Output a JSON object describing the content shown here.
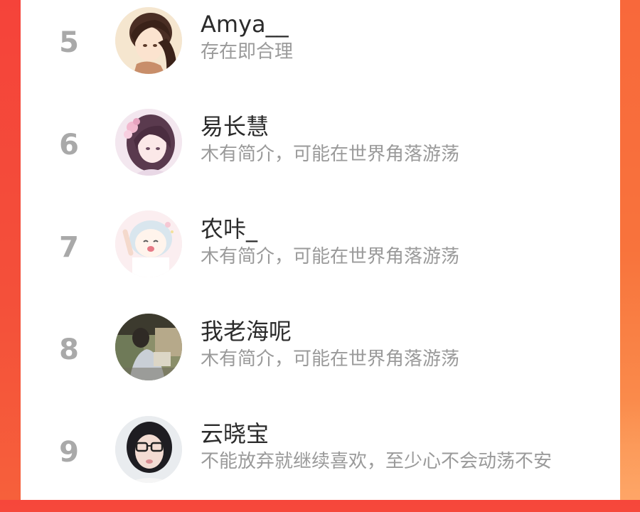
{
  "ranking": {
    "entries": [
      {
        "rank": "5",
        "name": "Amya__",
        "bio": "存在即合理",
        "avatar": "anime-boy-avatar"
      },
      {
        "rank": "6",
        "name": "易长慧",
        "bio": "木有简介，可能在世界角落游荡",
        "avatar": "anime-girl-flowers-avatar"
      },
      {
        "rank": "7",
        "name": "农咔_",
        "bio": "木有简介，可能在世界角落游荡",
        "avatar": "chibi-girl-avatar"
      },
      {
        "rank": "8",
        "name": "我老海呢",
        "bio": "木有简介，可能在世界角落游荡",
        "avatar": "street-photo-avatar"
      },
      {
        "rank": "9",
        "name": "云晓宝",
        "bio": "不能放弃就继续喜欢，至少心不会动荡不安",
        "avatar": "girl-glasses-photo-avatar"
      }
    ]
  },
  "colors": {
    "background_accent": "#f6473b",
    "card": "#ffffff",
    "rank_text": "#a9a9a9",
    "name_text": "#2b2b2b",
    "bio_text": "#9a9a9a"
  }
}
